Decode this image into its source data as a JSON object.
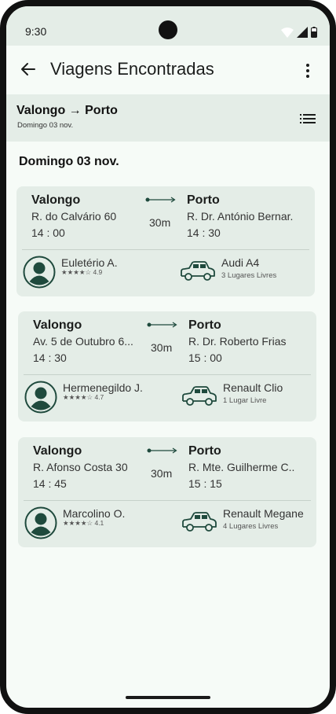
{
  "status": {
    "time": "9:30"
  },
  "appbar": {
    "title": "Viagens Encontradas"
  },
  "route": {
    "title": "Valongo → Porto",
    "date": "Domingo 03 nov."
  },
  "day_label": "Domingo 03 nov.",
  "trips": [
    {
      "origin": "Valongo",
      "origin_address": "R. do Calvário 60",
      "origin_time": "14 : 00",
      "duration": "30m",
      "destination": "Porto",
      "destination_address": "R. Dr. António Bernar.",
      "destination_time": "14 : 30",
      "driver": "Euletério A.",
      "rating": "★★★★☆ 4.9",
      "car": "Audi A4",
      "seats": "3 Lugares Livres"
    },
    {
      "origin": "Valongo",
      "origin_address": "Av. 5 de Outubro 6...",
      "origin_time": "14 : 30",
      "duration": "30m",
      "destination": "Porto",
      "destination_address": "R. Dr. Roberto Frias",
      "destination_time": "15 : 00",
      "driver": "Hermenegildo J.",
      "rating": "★★★★☆ 4.7",
      "car": "Renault Clio",
      "seats": "1 Lugar Livre"
    },
    {
      "origin": "Valongo",
      "origin_address": "R. Afonso Costa 30",
      "origin_time": "14 : 45",
      "duration": "30m",
      "destination": "Porto",
      "destination_address": "R. Mte. Guilherme C..",
      "destination_time": "15 : 15",
      "driver": "Marcolino O.",
      "rating": "★★★★☆ 4.1",
      "car": "Renault Megane",
      "seats": "4 Lugares Livres"
    }
  ],
  "colors": {
    "accent": "#1f4a3d",
    "surface": "#e4ede7",
    "background": "#f6fbf7"
  },
  "icons": [
    "back-arrow-icon",
    "more-vert-icon",
    "list-icon",
    "route-arrow-icon",
    "avatar-icon",
    "car-icon",
    "wifi-icon",
    "signal-icon",
    "battery-icon"
  ]
}
